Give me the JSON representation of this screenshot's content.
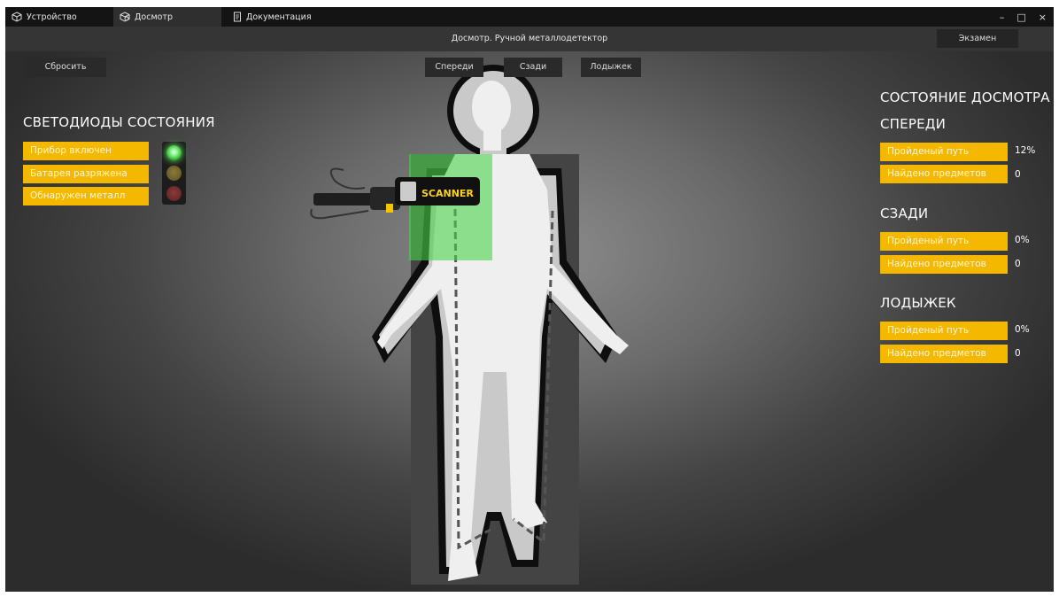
{
  "tabs": [
    {
      "label": "Устройство",
      "icon": "cube-icon",
      "active": false
    },
    {
      "label": "Досмотр",
      "icon": "inspection-icon",
      "active": true
    },
    {
      "label": "Документация",
      "icon": "document-icon",
      "active": false
    }
  ],
  "window_controls": {
    "minimize": "–",
    "maximize": "□",
    "close": "×"
  },
  "title": "Досмотр. Ручной металлодетектор",
  "exam_label": "Экзамен",
  "reset_label": "Сбросить",
  "views": {
    "front": "Спереди",
    "back": "Сзади",
    "ankle": "Лодыжек"
  },
  "leds": {
    "heading": "СВЕТОДИОДЫ СОСТОЯНИЯ",
    "items": [
      {
        "label": "Прибор включен",
        "state": "on",
        "color": "#4cd44c"
      },
      {
        "label": "Батарея разряжена",
        "state": "off",
        "color": "#6b5d25"
      },
      {
        "label": "Обнаружен металл",
        "state": "off",
        "color": "#6b2727"
      }
    ]
  },
  "status": {
    "heading": "СОСТОЯНИЕ ДОСМОТРА",
    "sections": [
      {
        "title": "СПЕРЕДИ",
        "path_label": "Пройденый путь",
        "path_value": "12%",
        "items_label": "Найдено предметов",
        "items_value": "0"
      },
      {
        "title": "СЗАДИ",
        "path_label": "Пройденый путь",
        "path_value": "0%",
        "items_label": "Найдено предметов",
        "items_value": "0"
      },
      {
        "title": "ЛОДЫЖЕК",
        "path_label": "Пройденый путь",
        "path_value": "0%",
        "items_label": "Найдено предметов",
        "items_value": "0"
      }
    ]
  },
  "scanner": {
    "brand": "SCANNER"
  },
  "colors": {
    "accent": "#f5b800",
    "highlight": "#4ad04a"
  }
}
